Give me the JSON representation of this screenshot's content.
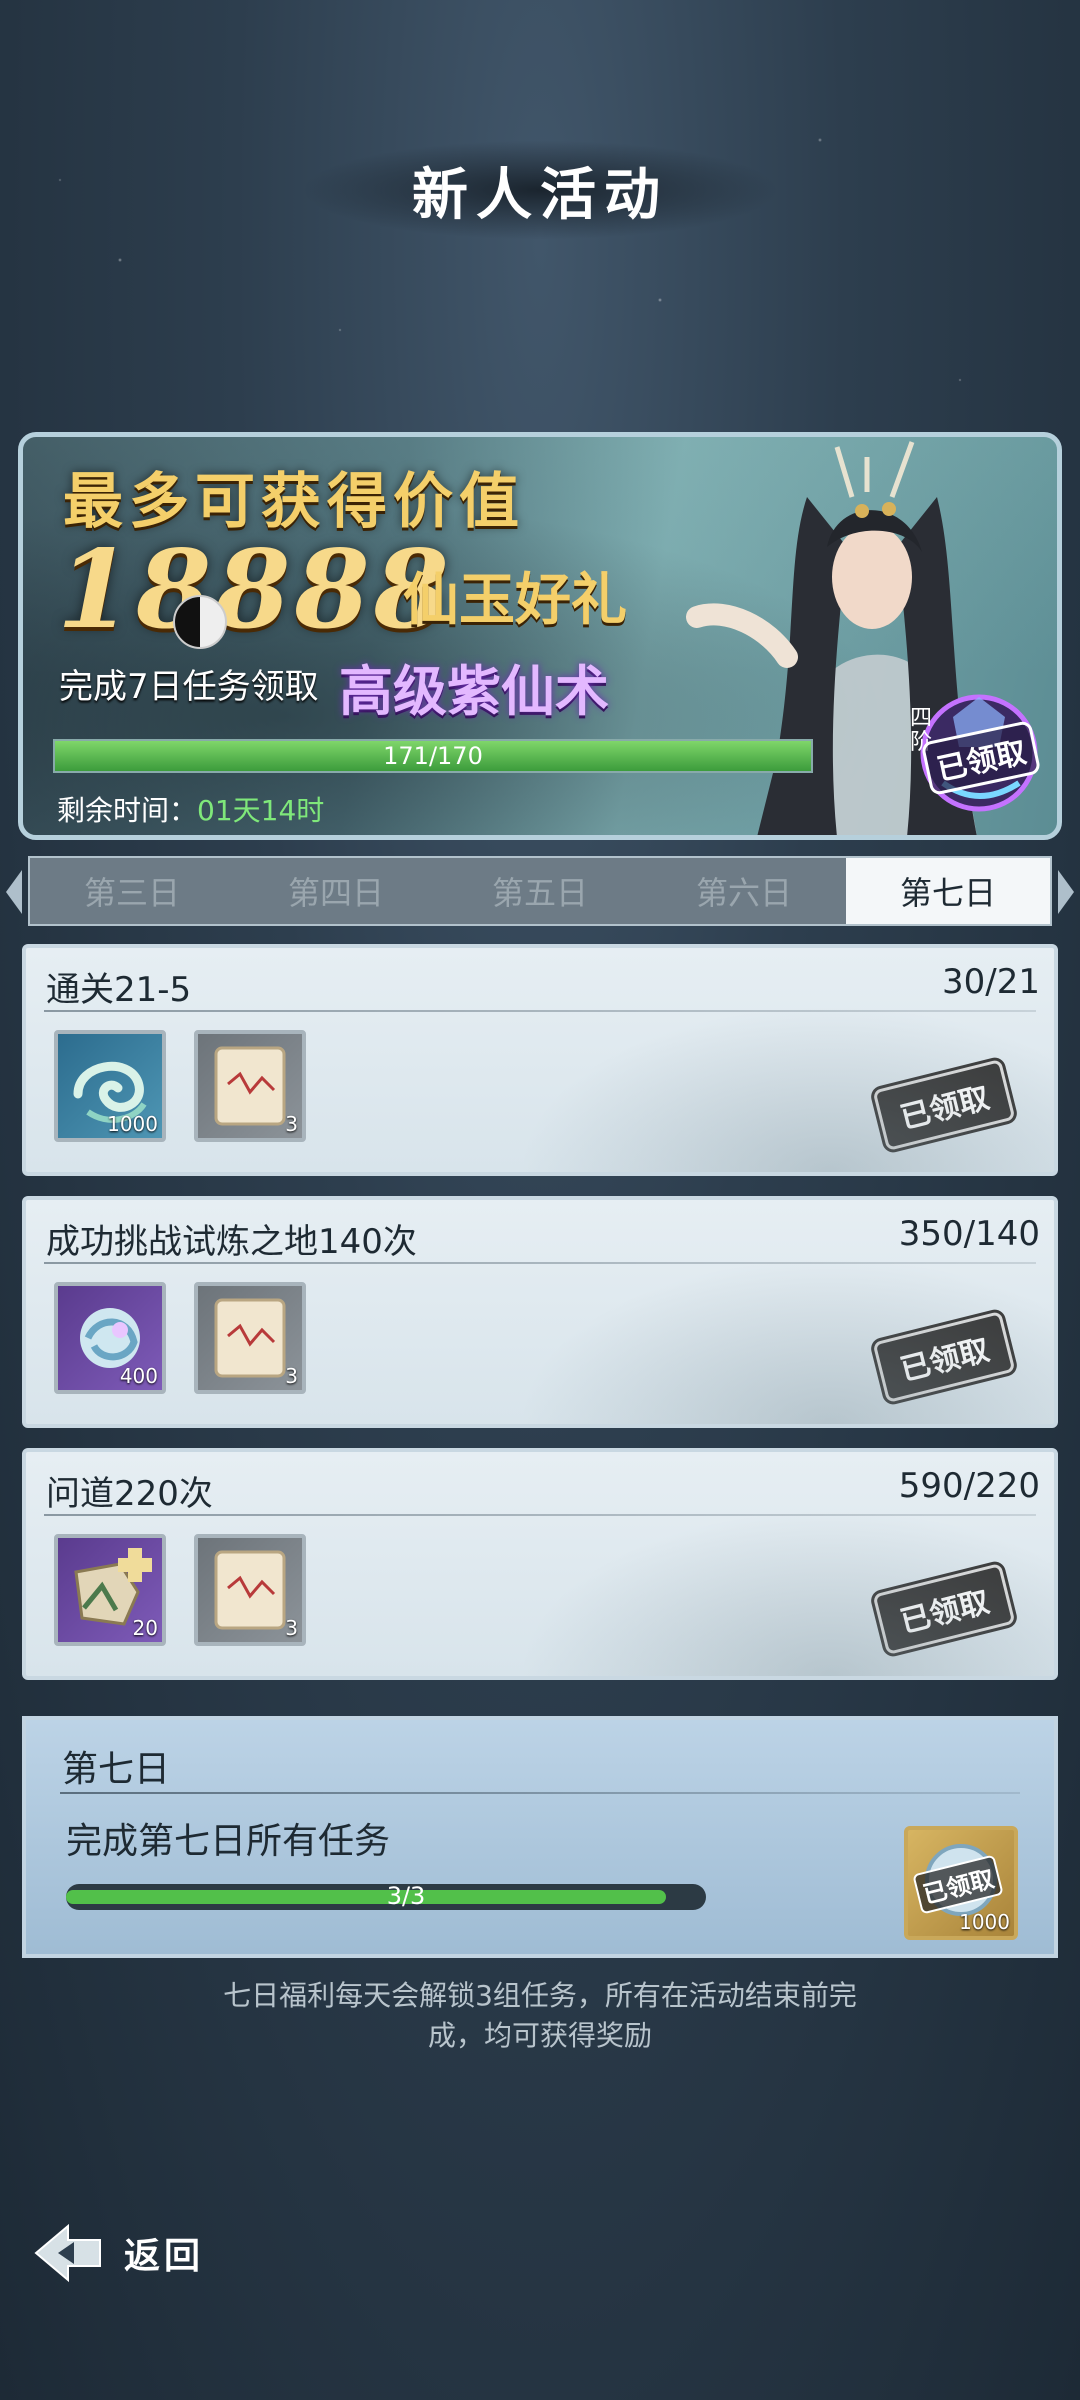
{
  "title": "新人活动",
  "banner": {
    "headline": "最多可获得价值",
    "amount": "18888",
    "amount_suffix": "仙玉好礼",
    "sub_left": "完成7日任务领取",
    "sub_right": "高级紫仙术",
    "progress_text": "171/170",
    "progress_fraction": 1.0,
    "remain_label": "剩余时间：",
    "remain_value": "01天14时",
    "stage_label": "四阶",
    "stage_status": "已领取"
  },
  "tabs": [
    {
      "label": "第三日",
      "active": false
    },
    {
      "label": "第四日",
      "active": false
    },
    {
      "label": "第五日",
      "active": false
    },
    {
      "label": "第六日",
      "active": false
    },
    {
      "label": "第七日",
      "active": true
    }
  ],
  "tasks": [
    {
      "name": "通关21-5",
      "count": "30/21",
      "reward1_qty": "1000",
      "reward2_qty": "3",
      "status": "已领取"
    },
    {
      "name": "成功挑战试炼之地140次",
      "count": "350/140",
      "reward1_qty": "400",
      "reward2_qty": "3",
      "status": "已领取"
    },
    {
      "name": "问道220次",
      "count": "590/220",
      "reward1_qty": "20",
      "reward2_qty": "3",
      "status": "已领取"
    }
  ],
  "day_reward": {
    "title": "第七日",
    "task": "完成第七日所有任务",
    "progress_text": "3/3",
    "progress_fraction": 1.0,
    "reward_qty": "1000",
    "status": "已领取"
  },
  "note": "七日福利每天会解锁3组任务，所有在活动结束前完成，均可获得奖励",
  "back_label": "返回",
  "colors": {
    "progress_green": "#52c04a",
    "gold": "#f4cf6a",
    "purple": "#e3b8ff"
  }
}
